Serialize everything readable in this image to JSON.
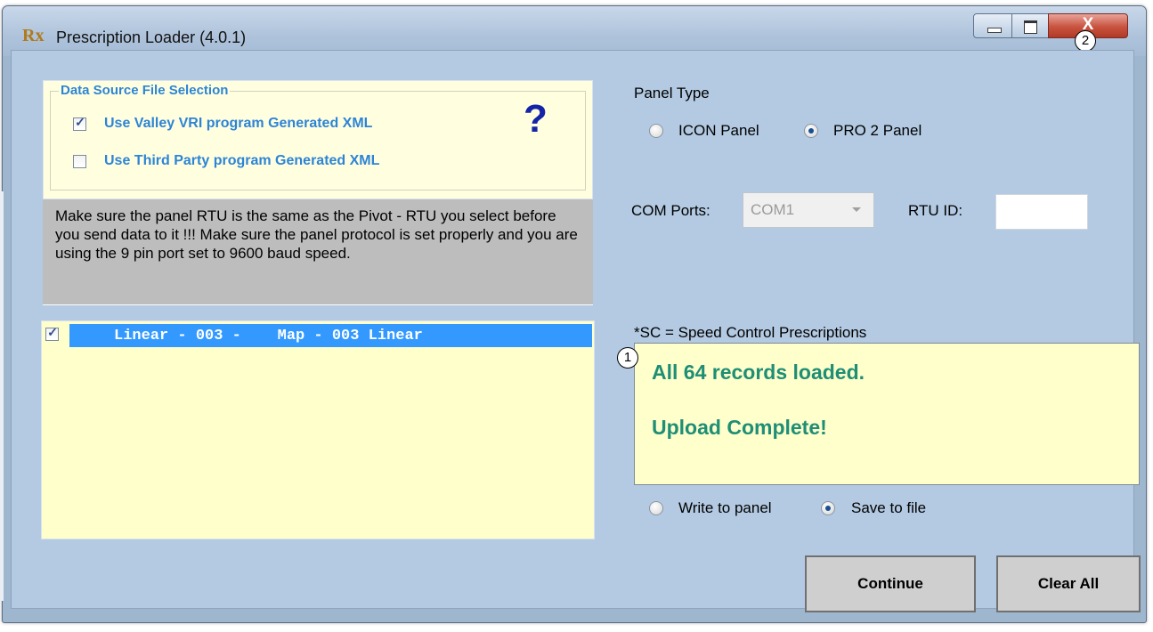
{
  "window": {
    "title": "Prescription Loader (4.0.1)",
    "app_icon": "Rx",
    "close_glyph": "X"
  },
  "callouts": {
    "one": "1",
    "two": "2"
  },
  "data_source": {
    "legend": "Data Source File Selection",
    "option_vri": {
      "label": "Use Valley VRI program  Generated XML",
      "checked": true
    },
    "option_third_party": {
      "label": "Use Third Party program  Generated XML",
      "checked": false
    },
    "help_icon": "?"
  },
  "warning_text": "Make sure the panel RTU is the same as the Pivot - RTU you select before you send data to it !!! Make sure the panel protocol is set properly and you are using the 9 pin port set to 9600 baud speed.",
  "prescription_list": {
    "items": [
      {
        "label": "Linear - 003 -    Map - 003 Linear",
        "checked": true,
        "selected": true
      }
    ]
  },
  "panel_type": {
    "label": "Panel Type",
    "options": [
      {
        "label": "ICON Panel",
        "selected": false
      },
      {
        "label": "PRO 2 Panel",
        "selected": true
      }
    ]
  },
  "com_ports": {
    "label": "COM Ports:",
    "value": "COM1"
  },
  "rtu_id": {
    "label": "RTU ID:",
    "value": ""
  },
  "sc_note": "*SC = Speed Control Prescriptions",
  "status": {
    "line1": "All 64 records loaded.",
    "line2": "Upload Complete!"
  },
  "output_mode": {
    "options": [
      {
        "label": "Write to panel",
        "selected": false
      },
      {
        "label": "Save to file",
        "selected": true
      }
    ]
  },
  "buttons": {
    "continue": "Continue",
    "clear_all": "Clear All"
  },
  "colors": {
    "title_bar": "#aec3db",
    "client_bg": "#b3cae2",
    "accent_blue": "#2d84d6",
    "selection": "#3399ff",
    "status_green": "#1e8e75",
    "close_red": "#c8533f"
  }
}
